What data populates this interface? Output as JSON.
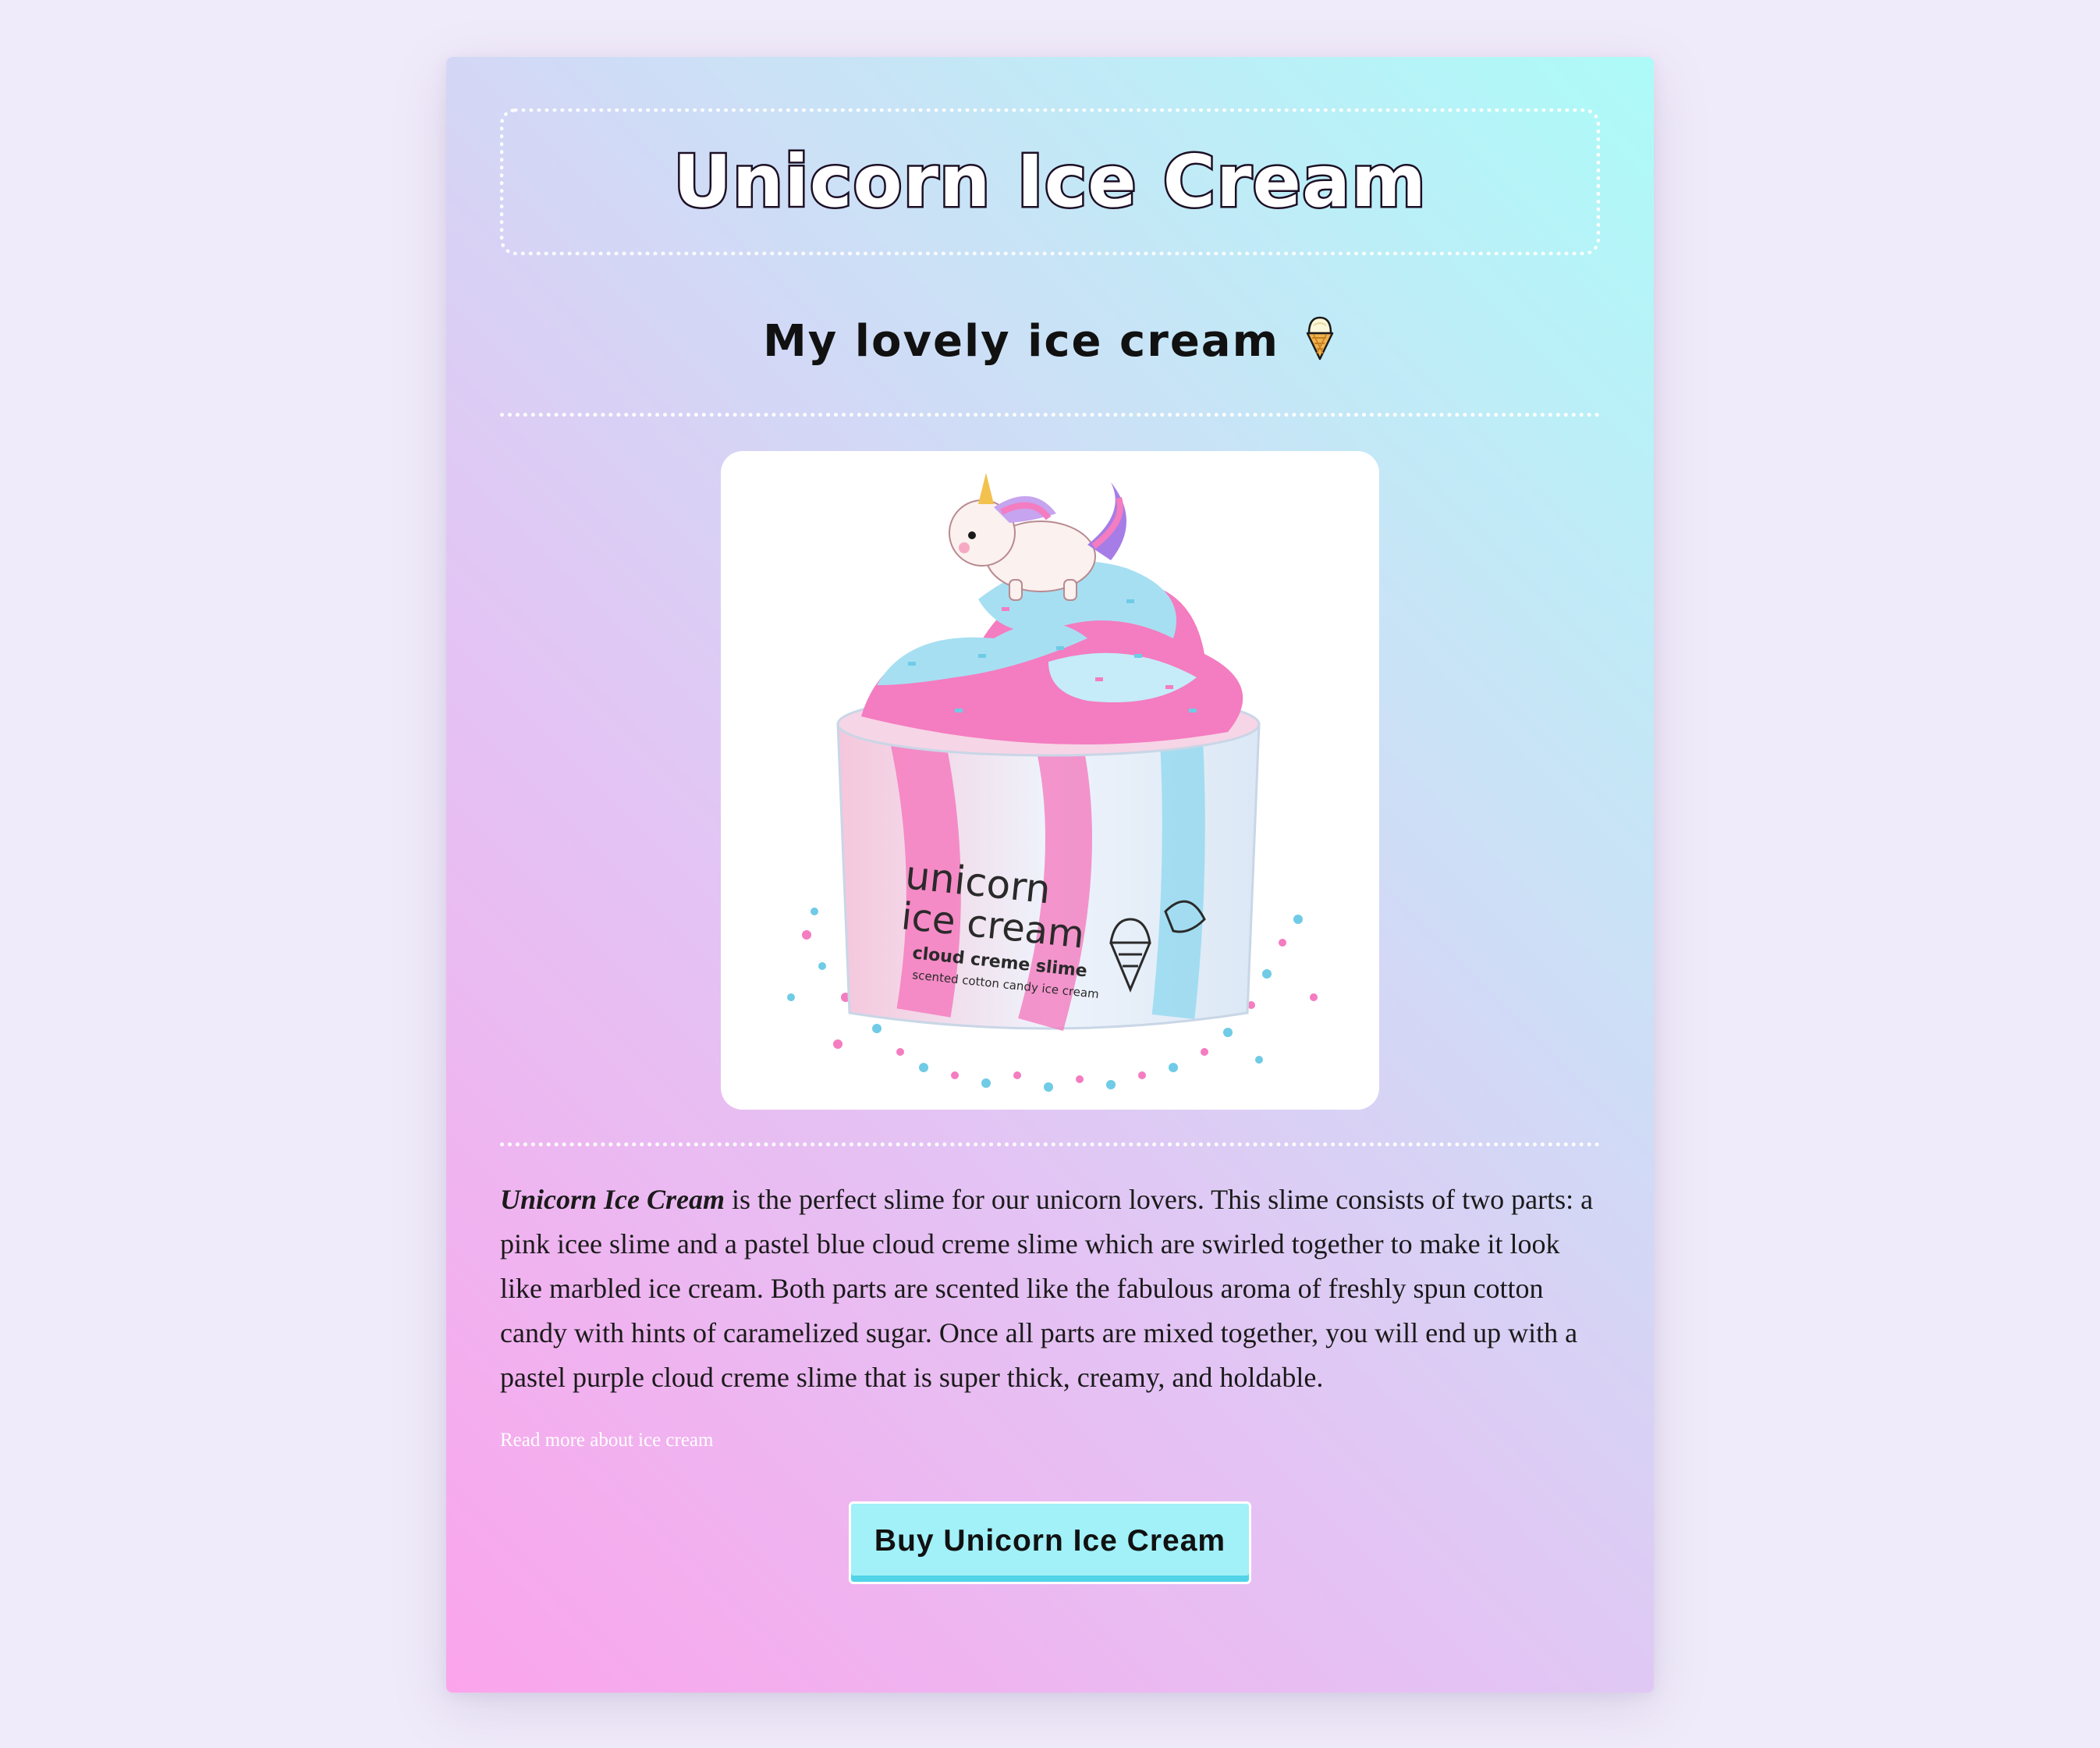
{
  "header": {
    "title": "Unicorn Ice Cream"
  },
  "subtitle": {
    "text": "My lovely ice cream"
  },
  "product_image": {
    "label_line1": "unicorn",
    "label_line2": "ice cream",
    "label_line3": "cloud creme slime",
    "label_line4": "scented cotton candy ice cream"
  },
  "description": {
    "name": "Unicorn Ice Cream",
    "body": " is the perfect slime for our unicorn lovers. This slime consists of two parts: a pink icee slime and a pastel blue cloud creme slime which are swirled together to make it look like marbled ice cream. Both parts are scented like the fabulous aroma of freshly spun cotton candy with hints of caramelized sugar. Once all parts are mixed together, you will end up with a pastel purple cloud creme slime that is super thick, creamy, and holdable."
  },
  "links": {
    "read_more": "Read more about ice cream"
  },
  "cta": {
    "buy_label": "Buy Unicorn Ice Cream"
  },
  "colors": {
    "pink": "#f47cc0",
    "blue": "#8ed7ef",
    "button": "#a2f0f8"
  },
  "icons": {
    "subtitle_icon": "ice-cream-cone-icon"
  }
}
